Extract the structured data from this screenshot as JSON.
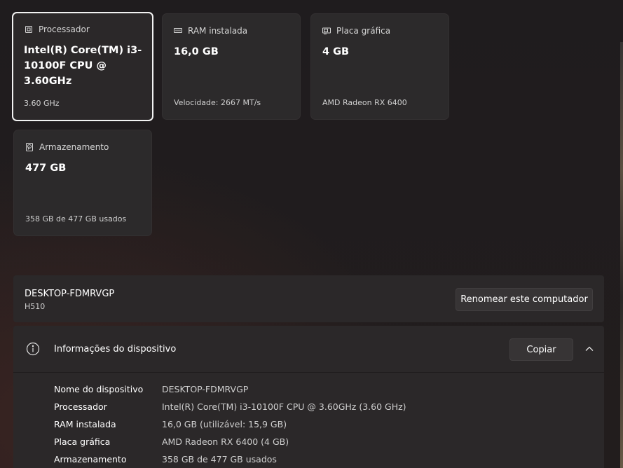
{
  "cards": {
    "processor": {
      "label": "Processador",
      "value": "Intel(R) Core(TM) i3-10100F CPU @ 3.60GHz",
      "sub": "3.60 GHz"
    },
    "ram": {
      "label": "RAM instalada",
      "value": "16,0 GB",
      "sub": "Velocidade: 2667 MT/s"
    },
    "gpu": {
      "label": "Placa gráfica",
      "value": "4 GB",
      "sub": "AMD Radeon RX 6400"
    },
    "storage": {
      "label": "Armazenamento",
      "value": "477 GB",
      "sub": "358 GB de 477 GB usados"
    }
  },
  "rename": {
    "device_name": "DESKTOP-FDMRVGP",
    "model": "H510",
    "button_label": "Renomear este computador"
  },
  "device_info": {
    "title": "Informações do dispositivo",
    "copy_label": "Copiar",
    "rows": [
      {
        "label": "Nome do dispositivo",
        "value": "DESKTOP-FDMRVGP"
      },
      {
        "label": "Processador",
        "value": "Intel(R) Core(TM) i3-10100F CPU @ 3.60GHz (3.60 GHz)"
      },
      {
        "label": "RAM instalada",
        "value": "16,0 GB (utilizável: 15,9 GB)"
      },
      {
        "label": "Placa gráfica",
        "value": "AMD Radeon RX 6400 (4 GB)"
      },
      {
        "label": "Armazenamento",
        "value": "358 GB de 477 GB usados"
      }
    ]
  }
}
